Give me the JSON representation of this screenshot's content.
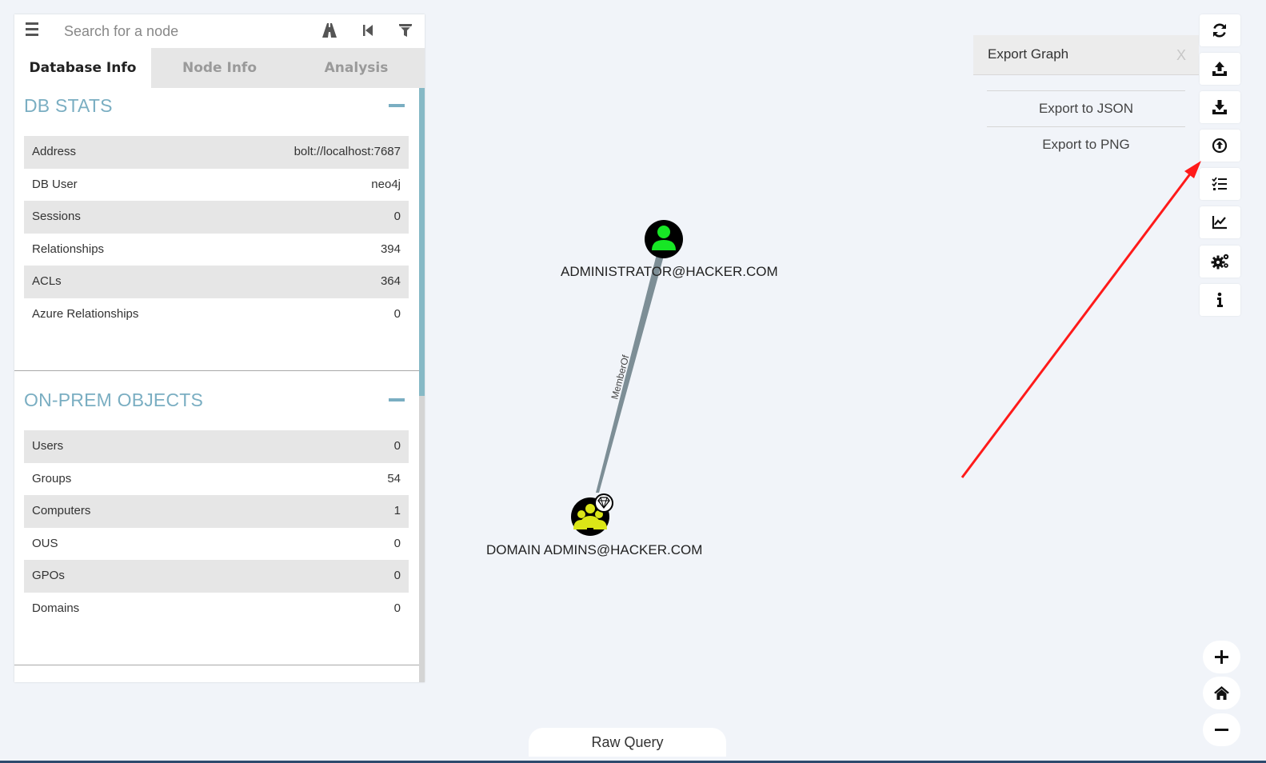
{
  "search": {
    "placeholder": "Search for a node",
    "icons": [
      "hamburger-menu-icon",
      "pathfinding-icon",
      "back-icon",
      "filter-icon"
    ]
  },
  "tabs": [
    {
      "label": "Database Info",
      "active": true
    },
    {
      "label": "Node Info",
      "active": false
    },
    {
      "label": "Analysis",
      "active": false
    }
  ],
  "db_stats": {
    "title": "DB STATS",
    "rows": [
      {
        "key": "Address",
        "value": "bolt://localhost:7687"
      },
      {
        "key": "DB User",
        "value": "neo4j"
      },
      {
        "key": "Sessions",
        "value": "0"
      },
      {
        "key": "Relationships",
        "value": "394"
      },
      {
        "key": "ACLs",
        "value": "364"
      },
      {
        "key": "Azure Relationships",
        "value": "0"
      }
    ]
  },
  "on_prem": {
    "title": "ON-PREM OBJECTS",
    "rows": [
      {
        "key": "Users",
        "value": "0"
      },
      {
        "key": "Groups",
        "value": "54"
      },
      {
        "key": "Computers",
        "value": "1"
      },
      {
        "key": "OUS",
        "value": "0"
      },
      {
        "key": "GPOs",
        "value": "0"
      },
      {
        "key": "Domains",
        "value": "0"
      }
    ]
  },
  "graph": {
    "nodes": [
      {
        "label": "ADMINISTRATOR@HACKER.COM",
        "type": "user",
        "color": "#17e625"
      },
      {
        "label": "DOMAIN ADMINS@HACKER.COM",
        "type": "group",
        "color": "#dbe617",
        "high_value": true
      }
    ],
    "edge": {
      "label": "MemberOf"
    }
  },
  "export": {
    "title": "Export Graph",
    "close": "X",
    "options": [
      "Export to JSON",
      "Export to PNG"
    ]
  },
  "toolbar": {
    "buttons": [
      "refresh-icon",
      "upload-icon",
      "download-icon",
      "import-icon",
      "checklist-icon",
      "chart-icon",
      "settings-icon",
      "info-icon"
    ],
    "zoom": [
      "zoom-in-icon",
      "home-icon",
      "zoom-out-icon"
    ]
  },
  "raw_query": {
    "label": "Raw Query"
  },
  "colors": {
    "accent": "#7aaec2",
    "annotation_arrow": "#ff1a1a",
    "edge": "#7d8e96"
  }
}
